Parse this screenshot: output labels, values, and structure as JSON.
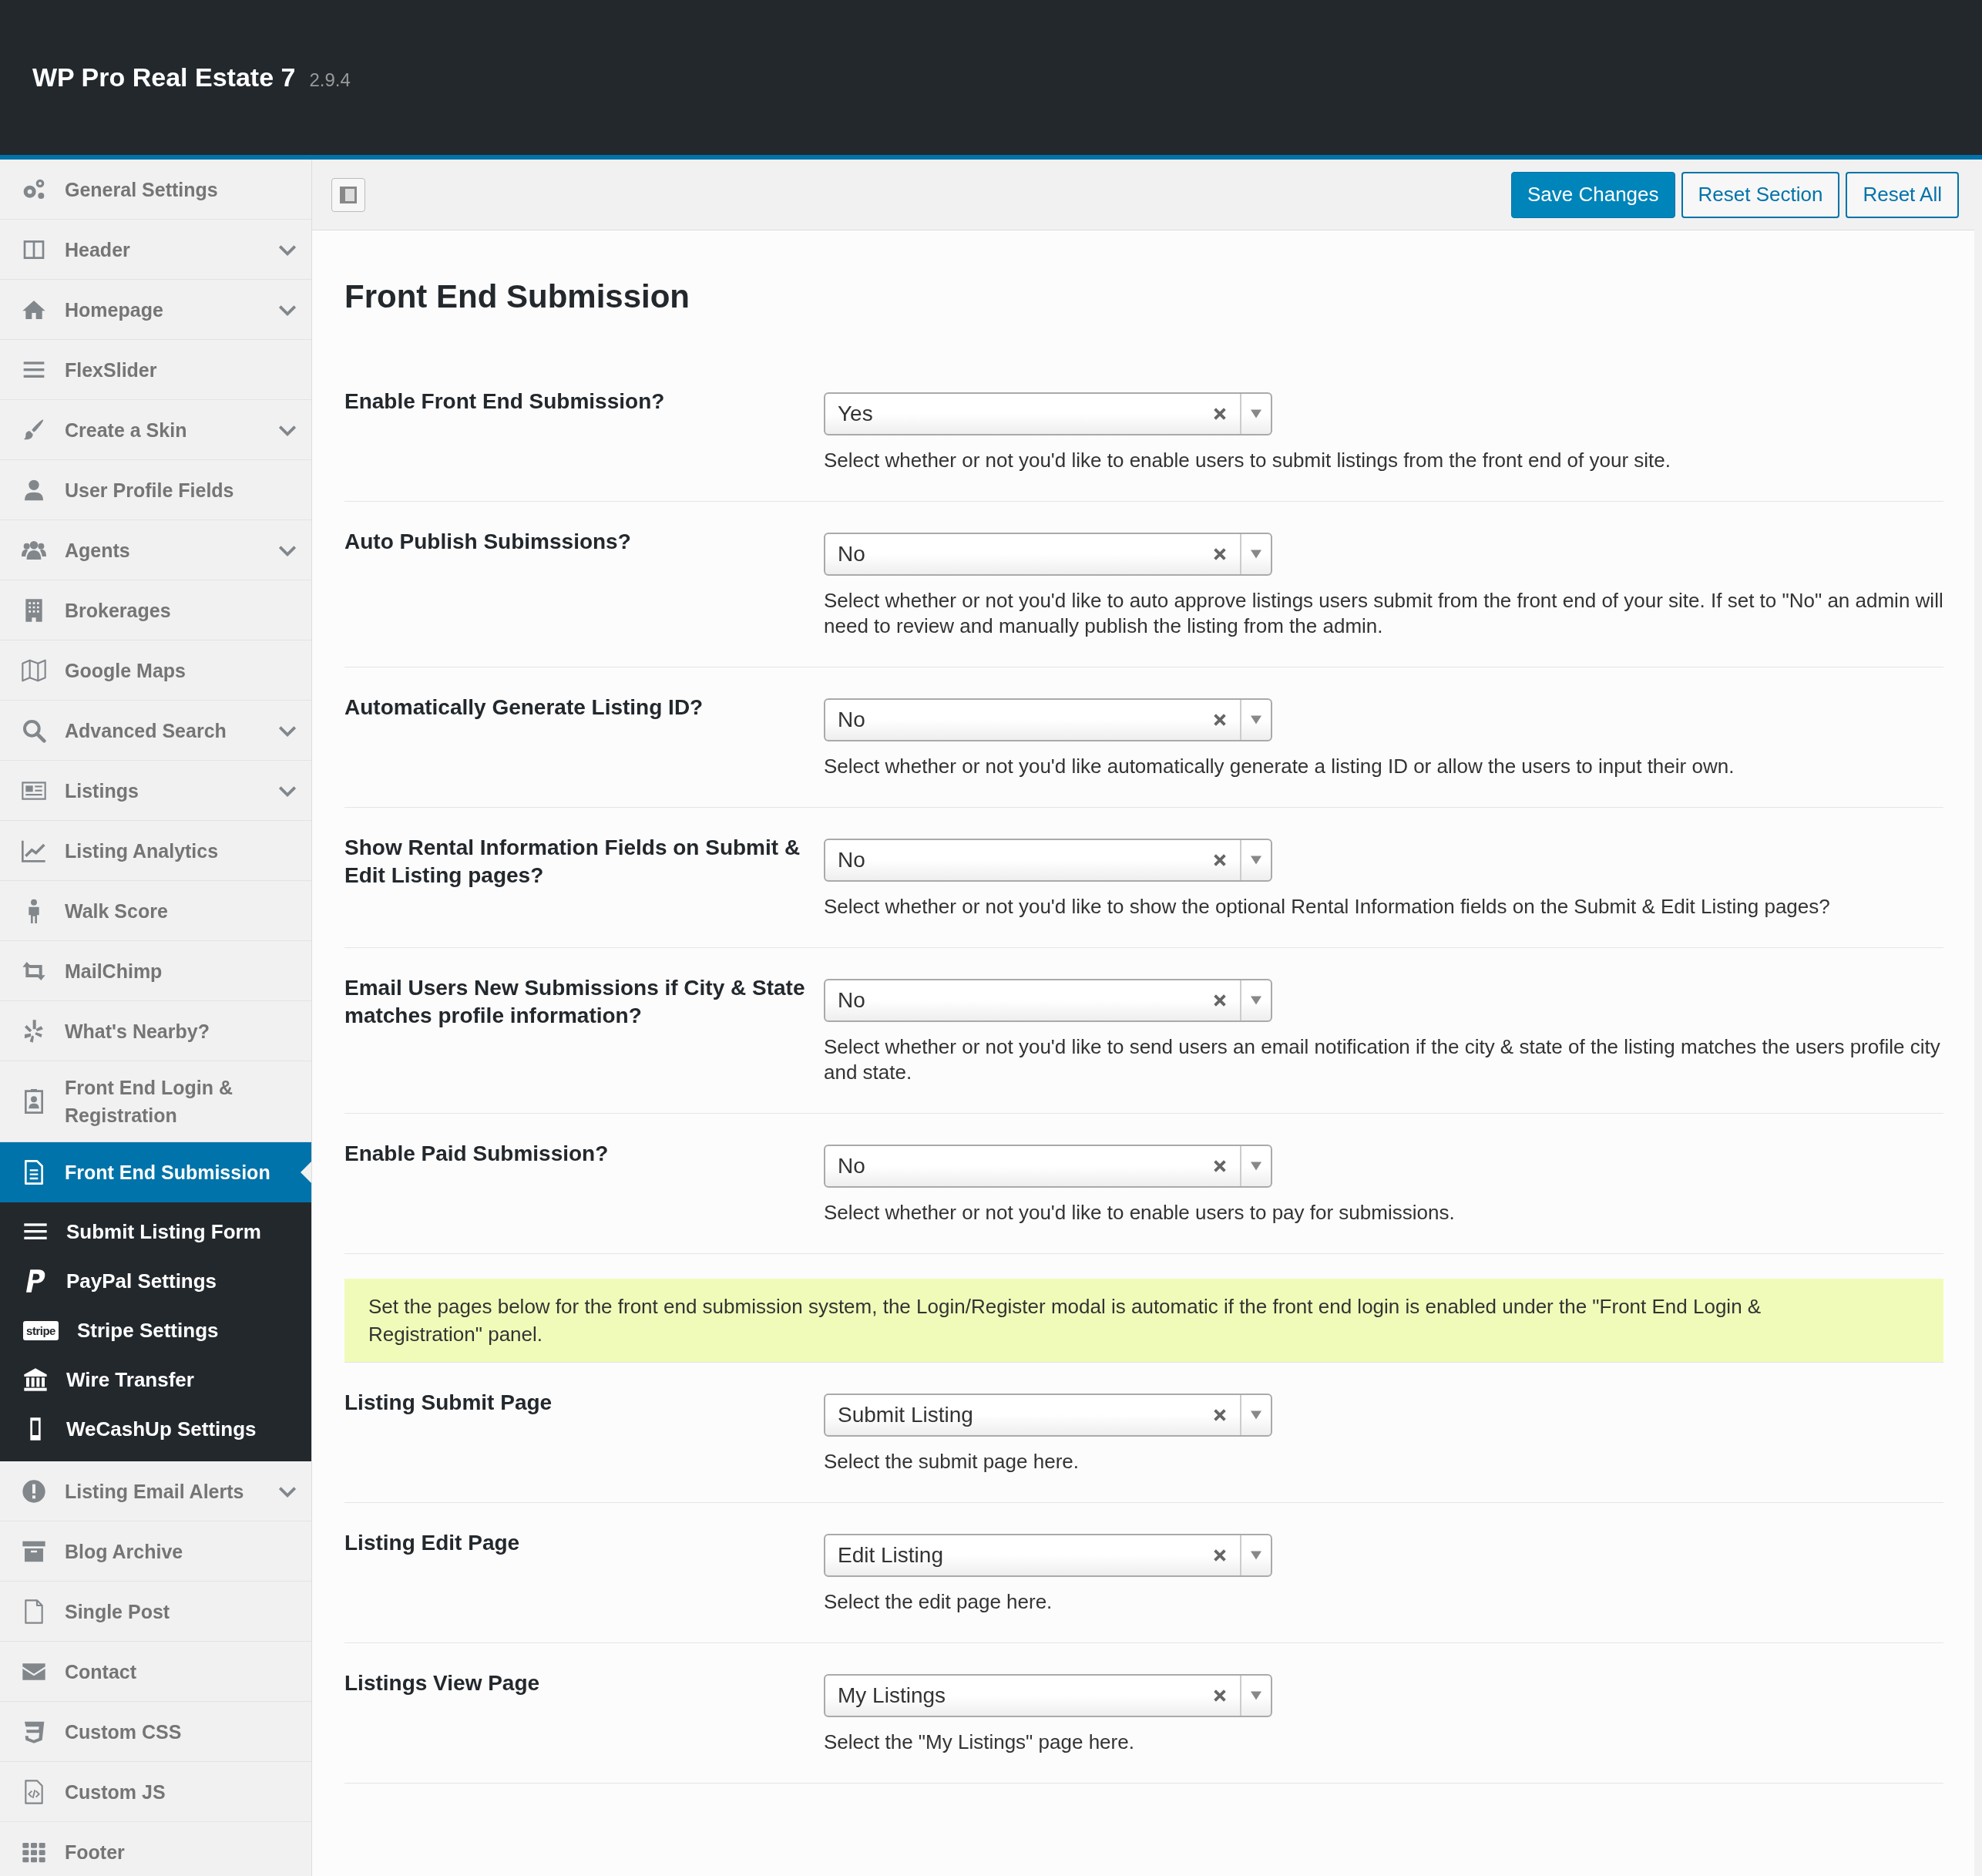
{
  "header": {
    "title": "WP Pro Real Estate 7",
    "version": "2.9.4"
  },
  "toolbar": {
    "buttons": [
      {
        "label": "Save Changes",
        "kind": "primary"
      },
      {
        "label": "Reset Section",
        "kind": "secondary"
      },
      {
        "label": "Reset All",
        "kind": "secondary"
      }
    ]
  },
  "sidebar": {
    "items": [
      {
        "label": "General Settings",
        "expandable": false,
        "selected": false
      },
      {
        "label": "Header",
        "expandable": true,
        "selected": false
      },
      {
        "label": "Homepage",
        "expandable": true,
        "selected": false
      },
      {
        "label": "FlexSlider",
        "expandable": false,
        "selected": false
      },
      {
        "label": "Create a Skin",
        "expandable": true,
        "selected": false
      },
      {
        "label": "User Profile Fields",
        "expandable": false,
        "selected": false
      },
      {
        "label": "Agents",
        "expandable": true,
        "selected": false
      },
      {
        "label": "Brokerages",
        "expandable": false,
        "selected": false
      },
      {
        "label": "Google Maps",
        "expandable": false,
        "selected": false
      },
      {
        "label": "Advanced Search",
        "expandable": true,
        "selected": false
      },
      {
        "label": "Listings",
        "expandable": true,
        "selected": false
      },
      {
        "label": "Listing Analytics",
        "expandable": false,
        "selected": false
      },
      {
        "label": "Walk Score",
        "expandable": false,
        "selected": false
      },
      {
        "label": "MailChimp",
        "expandable": false,
        "selected": false
      },
      {
        "label": "What's Nearby?",
        "expandable": false,
        "selected": false
      },
      {
        "label": "Front End Login & Registration",
        "expandable": false,
        "selected": false
      },
      {
        "label": "Front End Submission",
        "expandable": false,
        "selected": true,
        "children": [
          {
            "label": "Submit Listing Form"
          },
          {
            "label": "PayPal Settings"
          },
          {
            "label": "Stripe Settings",
            "icon_text": "stripe"
          },
          {
            "label": "Wire Transfer"
          },
          {
            "label": "WeCashUp Settings"
          }
        ]
      },
      {
        "label": "Listing Email Alerts",
        "expandable": true,
        "selected": false
      },
      {
        "label": "Blog Archive",
        "expandable": false,
        "selected": false
      },
      {
        "label": "Single Post",
        "expandable": false,
        "selected": false
      },
      {
        "label": "Contact",
        "expandable": false,
        "selected": false
      },
      {
        "label": "Custom CSS",
        "expandable": false,
        "selected": false
      },
      {
        "label": "Custom JS",
        "expandable": false,
        "selected": false
      },
      {
        "label": "Footer",
        "expandable": false,
        "selected": false
      }
    ]
  },
  "panel": {
    "title": "Front End Submission",
    "sections": [
      {
        "kind": "select",
        "label": "Enable Front End Submission?",
        "value": "Yes",
        "description": "Select whether or not you'd like to enable users to submit listings from the front end of your site."
      },
      {
        "kind": "select",
        "label": "Auto Publish Subimssions?",
        "value": "No",
        "description": "Select whether or not you'd like to auto approve listings users submit from the front end of your site. If set to \"No\" an admin will need to review and manually publish the listing from the admin."
      },
      {
        "kind": "select",
        "label": "Automatically Generate Listing ID?",
        "value": "No",
        "description": "Select whether or not you'd like automatically generate a listing ID or allow the users to input their own."
      },
      {
        "kind": "select",
        "label": "Show Rental Information Fields on Submit & Edit Listing pages?",
        "value": "No",
        "description": "Select whether or not you'd like to show the optional Rental Information fields on the Submit & Edit Listing pages?"
      },
      {
        "kind": "select",
        "label": "Email Users New Submissions if City & State matches profile information?",
        "value": "No",
        "description": "Select whether or not you'd like to send users an email notification if the city & state of the listing matches the users profile city and state."
      },
      {
        "kind": "select",
        "label": "Enable Paid Submission?",
        "value": "No",
        "description": "Select whether or not you'd like to enable users to pay for submissions."
      },
      {
        "kind": "notice",
        "text": "Set the pages below for the front end submission system, the Login/Register modal is automatic if the front end login is enabled under the \"Front End Login & Registration\" panel."
      },
      {
        "kind": "select",
        "label": "Listing Submit Page",
        "value": "Submit Listing",
        "description": "Select the submit page here."
      },
      {
        "kind": "select",
        "label": "Listing Edit Page",
        "value": "Edit Listing",
        "description": "Select the edit page here."
      },
      {
        "kind": "select",
        "label": "Listings View Page",
        "value": "My Listings",
        "description": "Select the \"My Listings\" page here."
      }
    ]
  }
}
